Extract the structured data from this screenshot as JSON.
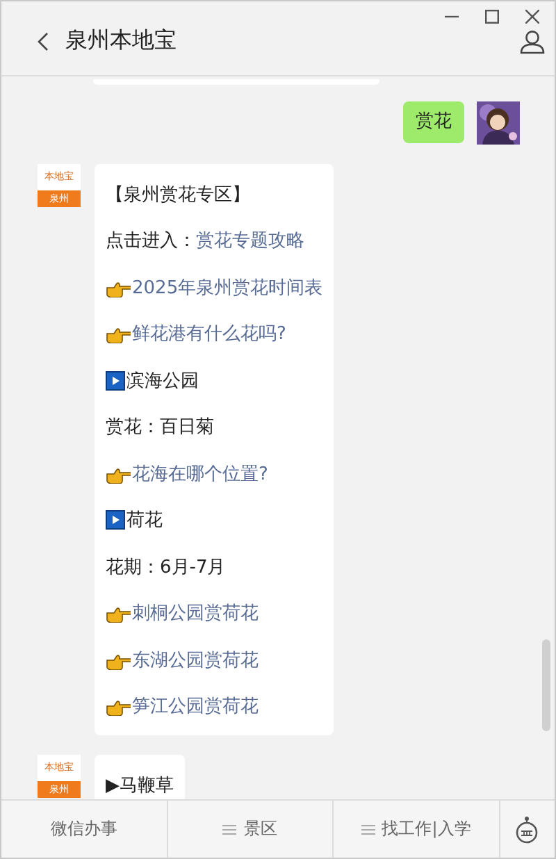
{
  "window": {
    "title": "泉州本地宝"
  },
  "messages": [
    {
      "outgoing": true,
      "kind": "text",
      "text": "赏花"
    },
    {
      "outgoing": false,
      "sender_logo": {
        "top": "本地宝",
        "bottom": "泉州"
      },
      "lines": [
        {
          "kind": "plain",
          "text": "【泉州赏花专区】"
        },
        {
          "kind": "label_link",
          "label": "点击进入：",
          "link": "赏花专题攻略"
        },
        {
          "kind": "pointer_link",
          "link": "2025年泉州赏花时间表"
        },
        {
          "kind": "pointer_link",
          "link": "鲜花港有什么花吗?"
        },
        {
          "kind": "play_heading",
          "text": "滨海公园"
        },
        {
          "kind": "plain",
          "text": "赏花：百日菊"
        },
        {
          "kind": "pointer_link",
          "link": "花海在哪个位置?"
        },
        {
          "kind": "play_heading",
          "text": "荷花"
        },
        {
          "kind": "plain",
          "text": "花期：6月-7月"
        },
        {
          "kind": "pointer_link",
          "link": "刺桐公园赏荷花"
        },
        {
          "kind": "pointer_link",
          "link": "东湖公园赏荷花"
        },
        {
          "kind": "pointer_link",
          "link": "笋江公园赏荷花"
        }
      ]
    },
    {
      "outgoing": false,
      "sender_logo": {
        "top": "本地宝",
        "bottom": "泉州"
      },
      "lines": [
        {
          "kind": "plain",
          "text": "▶马鞭草"
        }
      ]
    }
  ],
  "menu": [
    {
      "label": "微信办事",
      "has_submenu": false
    },
    {
      "label": "景区",
      "has_submenu": true
    },
    {
      "label": "找工作|入学",
      "has_submenu": true
    }
  ]
}
